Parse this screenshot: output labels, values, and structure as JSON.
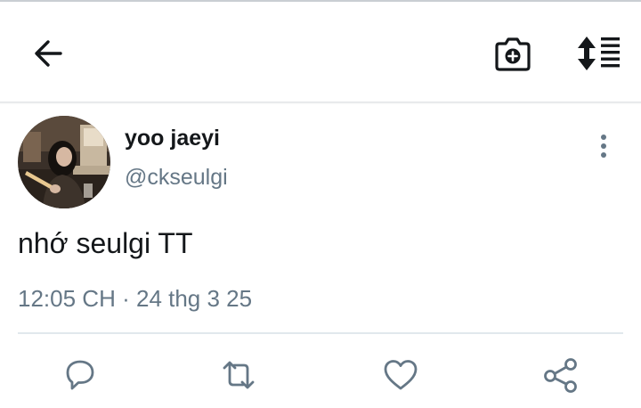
{
  "toolbar": {
    "back_icon": "arrow-left-icon",
    "camera_icon": "camera-add-icon",
    "sort_icon": "sort-order-icon"
  },
  "tweet": {
    "display_name": "yoo jaeyi",
    "handle": "@ckseulgi",
    "text": "nhớ seulgi TT",
    "time": "12:05 CH",
    "separator": "·",
    "date": "24 thg 3 25",
    "more_icon": "more-vertical-icon"
  },
  "actions": [
    {
      "name": "reply",
      "icon": "comment-icon"
    },
    {
      "name": "retweet",
      "icon": "retweet-icon"
    },
    {
      "name": "like",
      "icon": "heart-icon"
    },
    {
      "name": "share",
      "icon": "share-icon"
    }
  ],
  "colors": {
    "text_primary": "#14171a",
    "text_secondary": "#657786",
    "icon": "#657786",
    "divider": "#e1e8ed"
  }
}
